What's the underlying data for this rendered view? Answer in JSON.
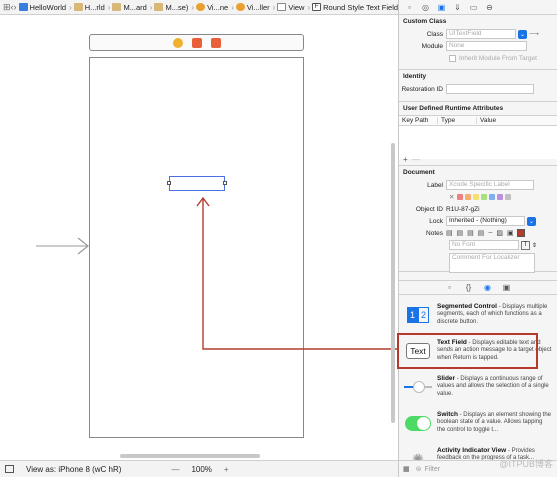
{
  "breadcrumbs": [
    "HelloWorld",
    "H...rld",
    "M...ard",
    "M...se)",
    "Vi...ne",
    "Vi...ller",
    "View",
    "Round Style Text Field"
  ],
  "bottombar": {
    "view_as": "View as: iPhone 8 (wC hR)",
    "zoom": "100%",
    "minus": "—",
    "plus": "+"
  },
  "inspector": {
    "custom_class": {
      "title": "Custom Class",
      "class_label": "Class",
      "class_value": "UITextField",
      "module_label": "Module",
      "module_value": "None",
      "inherit_label": "Inherit Module From Target"
    },
    "identity": {
      "title": "Identity",
      "restoration_label": "Restoration ID"
    },
    "runtime": {
      "title": "User Defined Runtime Attributes",
      "col_keypath": "Key Path",
      "col_type": "Type",
      "col_value": "Value",
      "add": "+",
      "remove": "—"
    },
    "document": {
      "title": "Document",
      "label_label": "Label",
      "label_placeholder": "Xcode Specific Label",
      "objectid_label": "Object ID",
      "objectid_value": "R1U-87-gZi",
      "lock_label": "Lock",
      "lock_value": "Inherited - (Nothing)",
      "notes_label": "Notes",
      "font_placeholder": "No Font",
      "comment_placeholder": "Comment For Localizer"
    }
  },
  "library": [
    {
      "title": "Segmented Control",
      "desc": " - Displays multiple segments, each of which functions as a discrete button.",
      "icon": "segmented-control-icon",
      "seg1": "1",
      "seg2": "2"
    },
    {
      "title": "Text Field",
      "desc": " - Displays editable text and sends an action message to a target object when Return is tapped.",
      "icon": "text-field-icon",
      "icon_text": "Text"
    },
    {
      "title": "Slider",
      "desc": " - Displays a continuous range of values and allows the selection of a single value.",
      "icon": "slider-icon"
    },
    {
      "title": "Switch",
      "desc": " - Displays an element showing the boolean state of a value. Allows tapping the control to toggle t...",
      "icon": "switch-icon"
    },
    {
      "title": "Activity Indicator View",
      "desc": " - Provides feedback on the progress of a task...",
      "icon": "activity-indicator-icon"
    }
  ],
  "filter_placeholder": "Filter",
  "watermark": "@ITPUB博客",
  "colors": {
    "accent": "#1a74e8",
    "highlight": "#b43b2c",
    "switch_green": "#4cd964"
  }
}
